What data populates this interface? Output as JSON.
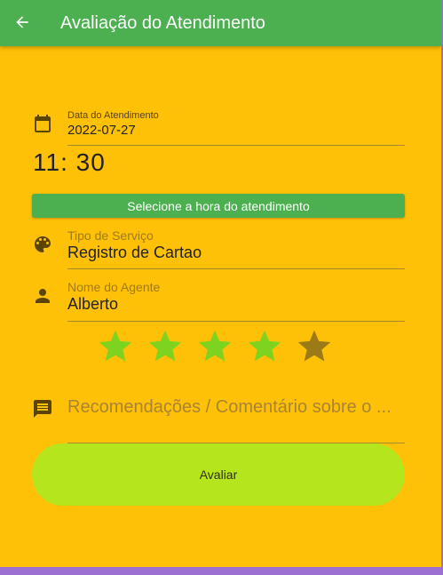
{
  "appbar": {
    "title": "Avaliação do Atendimento",
    "back_icon": "arrow-back-icon"
  },
  "form": {
    "date": {
      "label": "Data do Atendimento",
      "value": "2022-07-27",
      "icon": "calendar-icon"
    },
    "time": {
      "value": "11: 30"
    },
    "select_time_button": "Selecione a hora do atendimento",
    "service_type": {
      "label": "Tipo de Serviço",
      "value": "Registro de Cartao",
      "icon": "palette-icon"
    },
    "agent_name": {
      "label": "Nome do Agente",
      "value": "Alberto",
      "icon": "person-icon"
    },
    "rating": {
      "value": 4,
      "max": 5,
      "active_color": "#7ed321",
      "inactive_color": "#9c7a17"
    },
    "comment": {
      "placeholder": "Recomendações / Comentário sobre o ...",
      "icon": "comment-icon"
    },
    "submit_button": "Avaliar"
  },
  "colors": {
    "appbar": "#4caf50",
    "background": "#ffc107",
    "submit": "#b5e61d"
  }
}
